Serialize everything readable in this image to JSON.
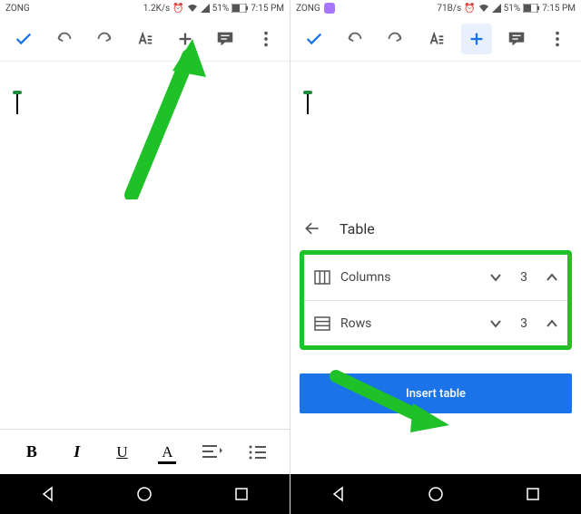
{
  "left": {
    "status": {
      "carrier": "ZONG",
      "speed": "1.2K/s",
      "battery": "51%",
      "time": "7:15 PM"
    },
    "doc": {
      "content": ""
    },
    "format": {
      "bold": "B",
      "italic": "I",
      "underline": "U",
      "text_color": "A"
    }
  },
  "right": {
    "status": {
      "carrier": "ZONG",
      "speed": "71B/s",
      "battery": "51%",
      "time": "7:15 PM"
    },
    "panel": {
      "title": "Table",
      "columns_label": "Columns",
      "rows_label": "Rows",
      "columns_value": "3",
      "rows_value": "3",
      "insert_label": "Insert table"
    }
  }
}
